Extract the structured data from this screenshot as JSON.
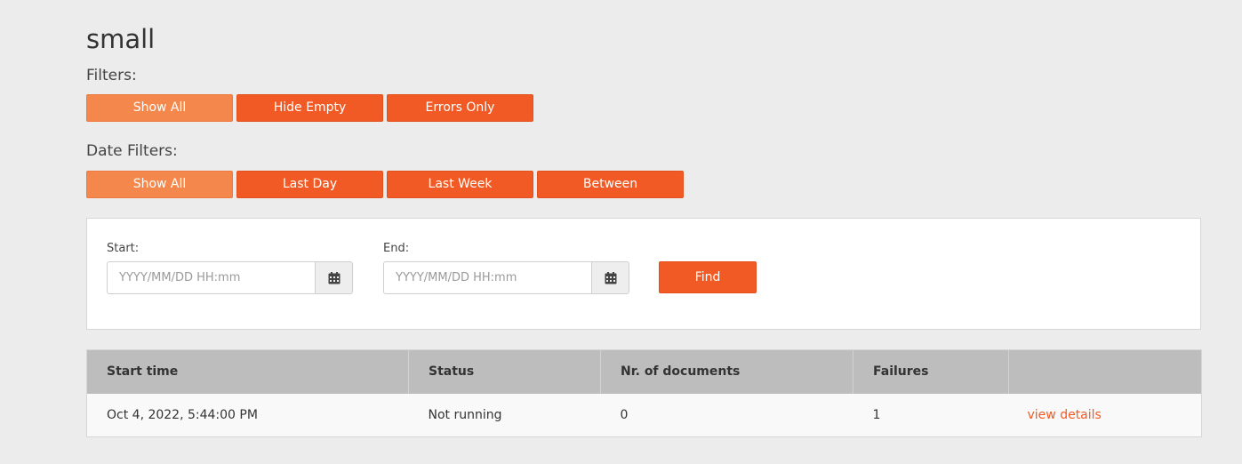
{
  "page": {
    "title": "small"
  },
  "filters": {
    "label": "Filters:",
    "buttons": [
      {
        "label": "Show All",
        "active": true
      },
      {
        "label": "Hide Empty",
        "active": false
      },
      {
        "label": "Errors Only",
        "active": false
      }
    ]
  },
  "date_filters": {
    "label": "Date Filters:",
    "buttons": [
      {
        "label": "Show All",
        "active": true
      },
      {
        "label": "Last Day",
        "active": false
      },
      {
        "label": "Last Week",
        "active": false
      },
      {
        "label": "Between",
        "active": false
      }
    ]
  },
  "date_range": {
    "start_label": "Start:",
    "start_placeholder": "YYYY/MM/DD HH:mm",
    "start_value": "",
    "end_label": "End:",
    "end_placeholder": "YYYY/MM/DD HH:mm",
    "end_value": "",
    "find_label": "Find",
    "calendar_icon": "calendar-icon"
  },
  "table": {
    "columns": [
      "Start time",
      "Status",
      "Nr. of documents",
      "Failures",
      ""
    ],
    "rows": [
      {
        "start_time": "Oct 4, 2022, 5:44:00 PM",
        "status": "Not running",
        "documents": "0",
        "failures": "1",
        "action": "view details"
      }
    ]
  },
  "colors": {
    "accent": "#f15a24",
    "accent_active": "#f4874c",
    "background": "#ececec",
    "table_header": "#bdbdbd"
  }
}
